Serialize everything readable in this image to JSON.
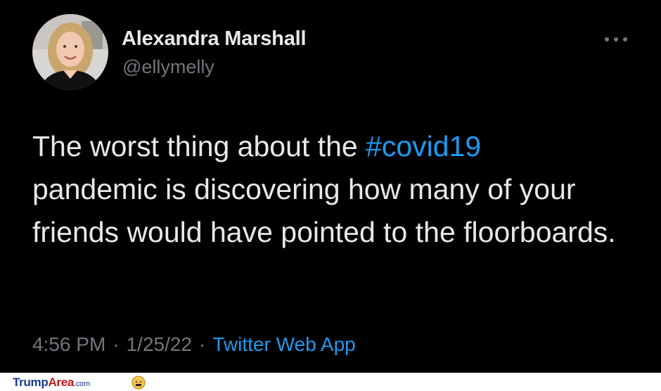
{
  "tweet": {
    "author_name": "Alexandra Marshall",
    "author_handle": "@ellymelly",
    "avatar_icon": "profile-photo",
    "more_icon": "more-options-icon",
    "text_before": "The worst thing about the ",
    "hashtag": "#covid19",
    "text_after": " pandemic is discovering how many of your friends would have pointed to the floorboards.",
    "time": "4:56 PM",
    "separator": "·",
    "date": "1/25/22",
    "source": "Twitter Web App"
  },
  "watermark": {
    "part1": "Trump",
    "part2": "Area",
    "part3": ".com",
    "icon": "trump-face-icon"
  },
  "colors": {
    "background": "#000000",
    "text": "#e7e9ea",
    "muted": "#71767b",
    "link": "#1d9bf0"
  }
}
